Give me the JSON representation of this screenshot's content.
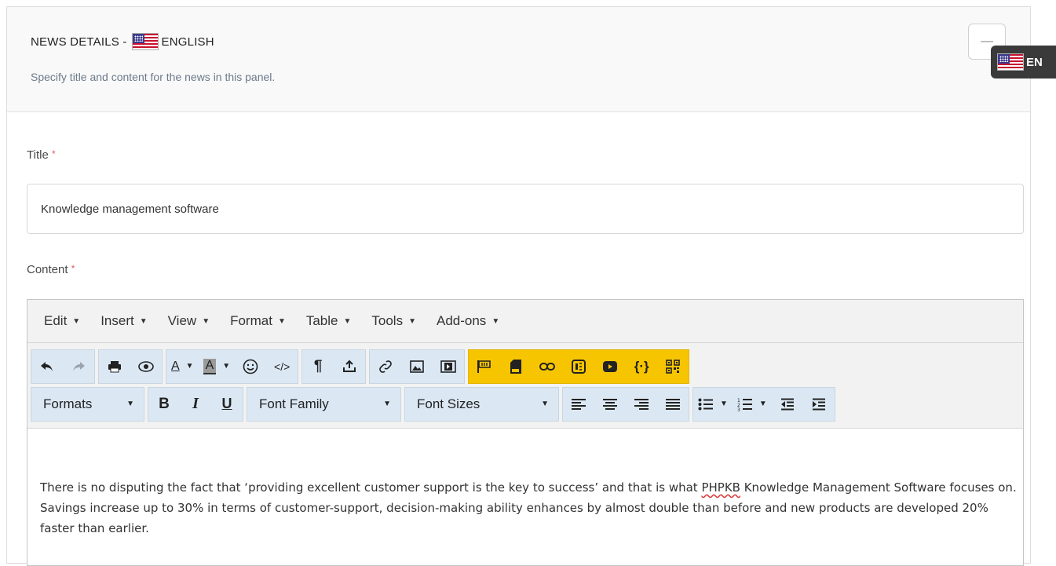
{
  "panel": {
    "title_prefix": "NEWS DETAILS -",
    "title_lang": "ENGLISH",
    "subtitle": "Specify title and content for the news in this panel.",
    "collapse_symbol": "—"
  },
  "language_tab": {
    "code": "EN"
  },
  "form": {
    "title_label": "Title",
    "required_mark": "*",
    "title_value": "Knowledge management software",
    "content_label": "Content"
  },
  "editor": {
    "menu": [
      "Edit",
      "Insert",
      "View",
      "Format",
      "Table",
      "Tools",
      "Add-ons"
    ],
    "toolbar2": {
      "formats": "Formats",
      "bold": "B",
      "italic": "I",
      "underline": "U",
      "font_family": "Font Family",
      "font_sizes": "Font Sizes"
    },
    "content_parts": [
      "There is no disputing the fact that ‘providing excellent customer support is the key to success’ and that is what ",
      "PHPKB",
      " Knowledge Management Software focuses on. Savings increase up to 30% in terms of customer-support, decision-making ability enhances by almost double than before and new products are developed 20% faster than earlier."
    ]
  },
  "colors": {
    "toolbar_group_bg": "#dbe8f4",
    "addon_group_bg": "#f7c500",
    "required": "#e05b5b",
    "lang_tab_bg": "#3a3a3a"
  }
}
